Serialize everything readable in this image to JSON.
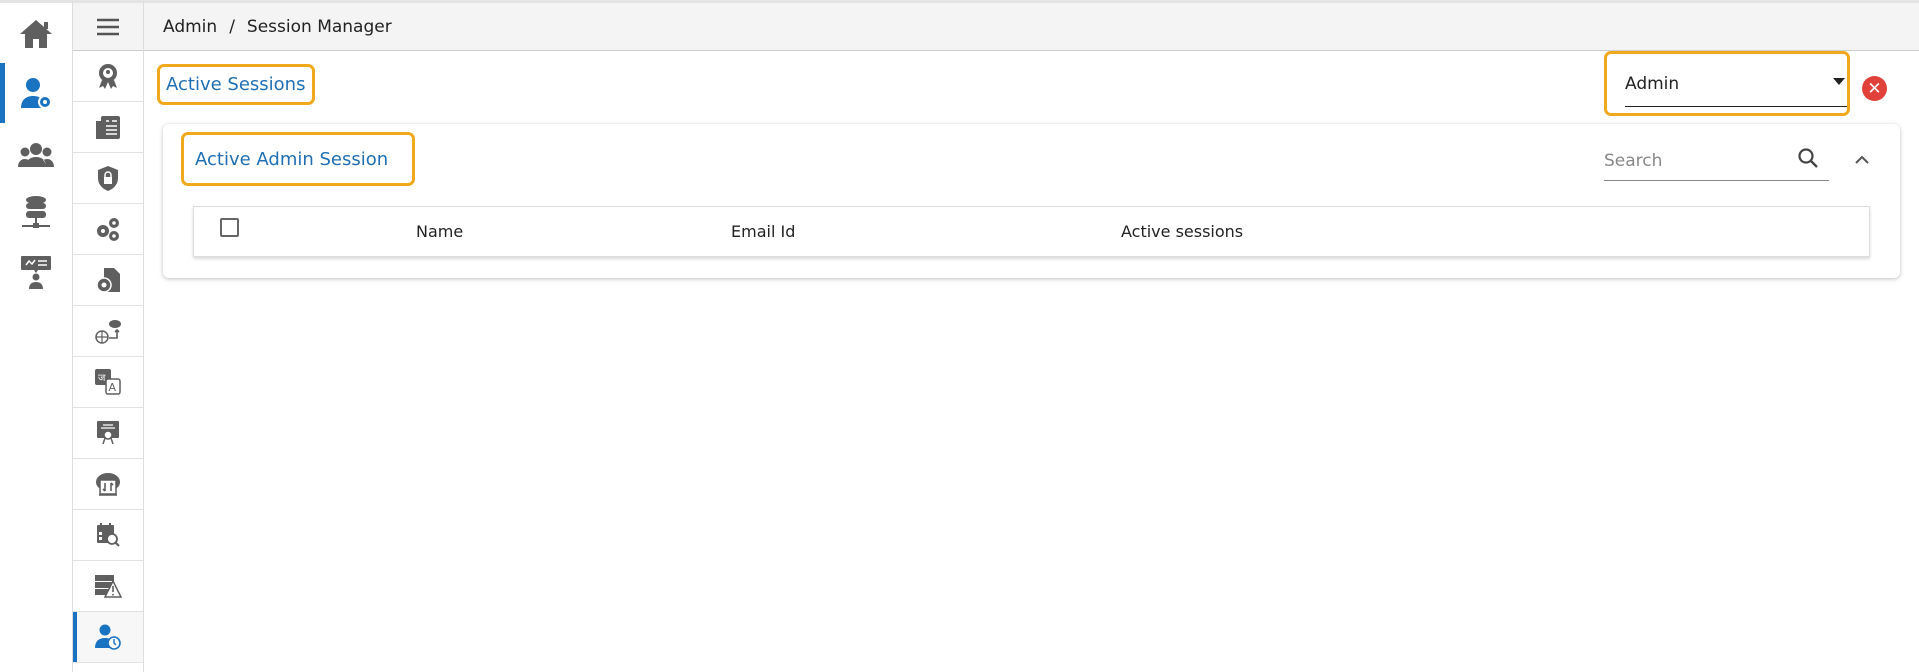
{
  "breadcrumb": {
    "root": "Admin",
    "separator": "/",
    "current": "Session Manager"
  },
  "rail": [
    "home-icon",
    "user-gear-icon",
    "users-icon",
    "database-network-icon",
    "presentation-user-icon"
  ],
  "sidebar": [
    "award-icon",
    "billing-icon",
    "shield-lock-icon",
    "gears-icon",
    "document-gear-icon",
    "globe-cloud-icon",
    "translate-icon",
    "certificate-icon",
    "cloud-transfer-icon",
    "calendar-search-icon",
    "server-warning-icon",
    "user-clock-icon"
  ],
  "page": {
    "title": "Active Sessions",
    "dropdown_value": "Admin",
    "close_label": "✕"
  },
  "card": {
    "title": "Active Admin Session",
    "search_placeholder": "Search",
    "columns": [
      "Name",
      "Email Id",
      "Active sessions"
    ]
  },
  "colors": {
    "accent": "#1f6fb2",
    "highlight": "#f0a81c",
    "danger": "#e0413a",
    "icon": "#5f5f5f"
  }
}
